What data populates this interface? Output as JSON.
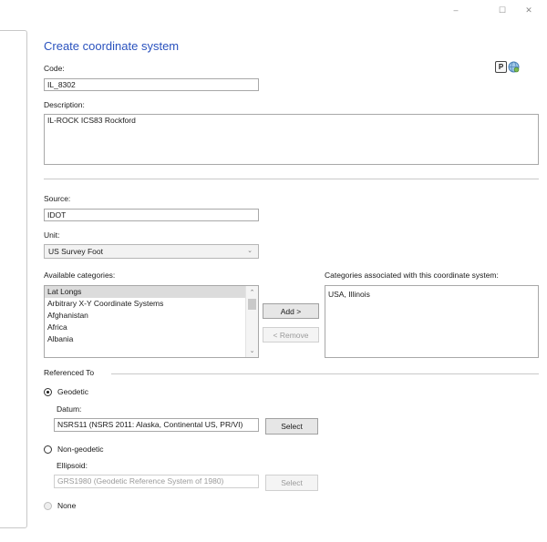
{
  "window": {
    "minimize_glyph": "–",
    "maximize_glyph": "☐",
    "close_glyph": "✕"
  },
  "form": {
    "title": "Create coordinate system",
    "code": {
      "label": "Code:",
      "value": "IL_8302"
    },
    "description": {
      "label": "Description:",
      "value": "IL-ROCK ICS83 Rockford"
    },
    "source": {
      "label": "Source:",
      "value": "IDOT"
    },
    "unit": {
      "label": "Unit:",
      "value": "US Survey Foot"
    },
    "available_categories": {
      "label": "Available categories:",
      "items": [
        "Lat Longs",
        "Arbitrary X-Y Coordinate Systems",
        "Afghanistan",
        "Africa",
        "Albania"
      ],
      "selected_index": 0
    },
    "associated_categories": {
      "label": "Categories associated with this coordinate system:",
      "items": [
        "USA, Illinois"
      ]
    },
    "add_button": "Add >",
    "remove_button": "< Remove",
    "referenced_to": {
      "label": "Referenced To",
      "geodetic": {
        "label": "Geodetic",
        "checked": true
      },
      "datum": {
        "label": "Datum:",
        "value": "NSRS11 (NSRS 2011: Alaska, Continental US, PR/VI)",
        "select_label": "Select"
      },
      "non_geodetic": {
        "label": "Non-geodetic",
        "checked": false
      },
      "ellipsoid": {
        "label": "Ellipsoid:",
        "value": "GRS1980 (Geodetic Reference System of 1980)",
        "select_label": "Select"
      },
      "none": {
        "label": "None",
        "checked": false
      }
    }
  },
  "icons": {
    "p_letter": "P"
  }
}
